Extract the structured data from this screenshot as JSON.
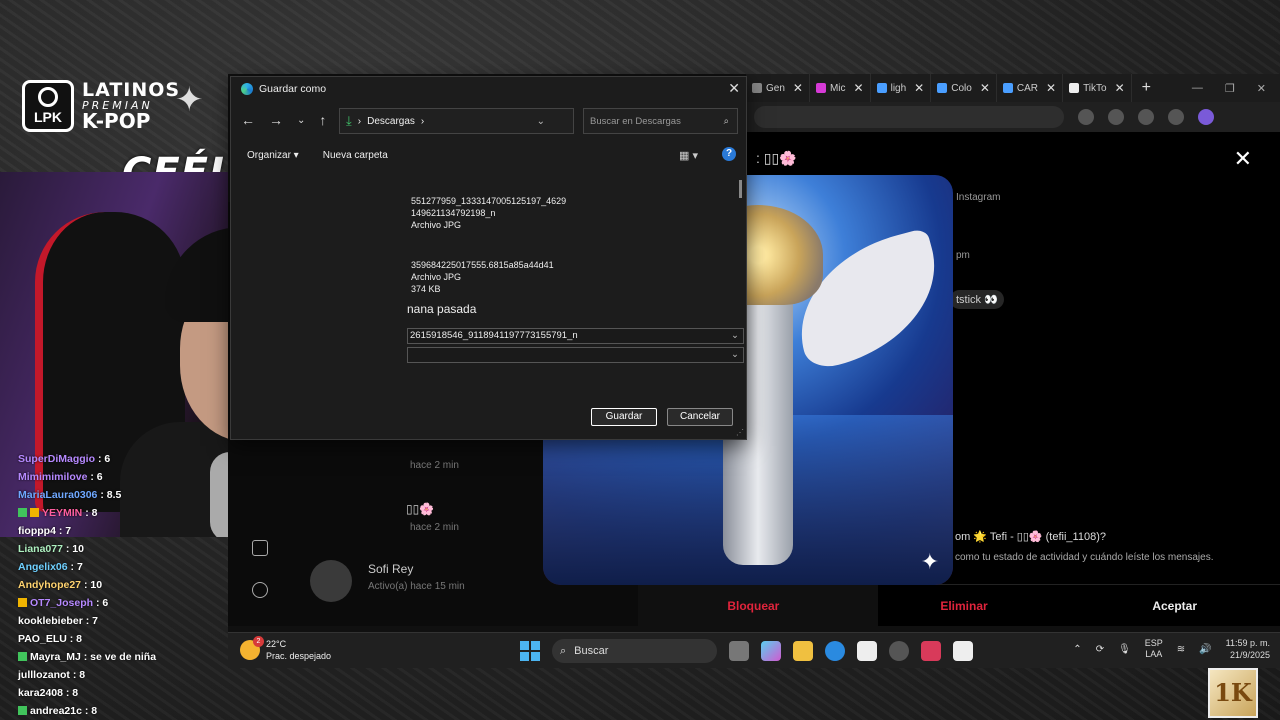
{
  "overlay": {
    "logo_badge": "LPK",
    "logo_line1": "LATINOS",
    "logo_line2": "PREMIAN",
    "logo_line3": "K-POP",
    "streamer_tag": "CEÉLE",
    "corner_logo": "1K"
  },
  "chat": [
    {
      "user": "SuperDiMaggio",
      "msg": ": 6",
      "color": "#b689ff"
    },
    {
      "user": "Mimimimilove",
      "msg": ": 6",
      "color": "#b689ff"
    },
    {
      "user": "MariaLaura0306",
      "msg": ": 8.5",
      "color": "#6fa8ff"
    },
    {
      "user": "YEYMIN",
      "msg": ": 8",
      "color": "#ff5fa0",
      "badges": [
        "#41c45c",
        "#f0b400"
      ]
    },
    {
      "user": "fioppp4",
      "msg": ": 7",
      "color": "#ffffff"
    },
    {
      "user": "Liana077",
      "msg": ": 10",
      "color": "#aef0c0"
    },
    {
      "user": "Angelix06",
      "msg": ": 7",
      "color": "#6fd0ff"
    },
    {
      "user": "Andyhope27",
      "msg": ": 10",
      "color": "#ffd36f"
    },
    {
      "user": "OT7_Joseph",
      "msg": ": 6",
      "color": "#b689ff",
      "badges": [
        "#f0b400"
      ]
    },
    {
      "user": "kooklebieber",
      "msg": ": 7",
      "color": "#ffffff"
    },
    {
      "user": "PAO_ELU",
      "msg": ": 8",
      "color": "#ffffff"
    },
    {
      "user": "Mayra_MJ",
      "msg": ": se ve de niña",
      "color": "#ffffff",
      "badges": [
        "#41c45c"
      ]
    },
    {
      "user": "julllozanot",
      "msg": ": 8",
      "color": "#ffffff"
    },
    {
      "user": "kara2408",
      "msg": ": 8",
      "color": "#ffffff"
    },
    {
      "user": "andrea21c",
      "msg": ": 8",
      "color": "#ffffff",
      "badges": [
        "#41c45c"
      ]
    }
  ],
  "browser": {
    "tabs": [
      {
        "label": "Gen",
        "color": "#888"
      },
      {
        "label": "Mic",
        "color": "#d63ad6"
      },
      {
        "label": "ligh",
        "color": "#4a9eff"
      },
      {
        "label": "Colo",
        "color": "#4a9eff"
      },
      {
        "label": "CAR",
        "color": "#4a9eff"
      },
      {
        "label": "TikTo",
        "color": "#eee"
      }
    ],
    "new_tab": "+",
    "close_glyph": "✕"
  },
  "instagram": {
    "chat_title": ": ▯▯🌸",
    "close": "✕",
    "label_instagram": "Instagram",
    "time_pm": "pm",
    "lightstick_text": "tstick 👀",
    "row1_time": "hace 2 min",
    "row2_label": "▯▯🌸",
    "row2_time": "hace 2 min",
    "sofi_name": "Sofi Rey",
    "sofi_status": "Activo(a) hace 15 min",
    "request_title": "om 🌟 Tefi - ▯▯🌸 (tefii_1108)?",
    "request_sub": "como tu estado de actividad y cuándo leíste los mensajes.",
    "actions": [
      "Bloquear",
      "Eliminar",
      "Aceptar"
    ]
  },
  "dialog": {
    "title": "Guardar como",
    "close": "✕",
    "path_folder": "Descargas",
    "path_sep": "›",
    "search_placeholder": "Buscar en Descargas",
    "organize": "Organizar ▾",
    "new_folder": "Nueva carpeta",
    "help": "?",
    "files": [
      {
        "line1": "551277959_1333147005125197_4629",
        "line2": "149621134792198_n",
        "line3": "Archivo JPG"
      },
      {
        "line1": "359684225017555.6815a85a44d41",
        "line2": "Archivo JPG",
        "line3": "374 KB"
      }
    ],
    "group_header": "nana pasada",
    "filename_value": "2615918546_9118941197773155791_n",
    "filetype_value": "",
    "save_button": "Guardar",
    "cancel_button": "Cancelar"
  },
  "taskbar": {
    "temp": "22°C",
    "condition": "Prac. despejado",
    "weather_badge": "2",
    "search_label": "Buscar",
    "lang1": "ESP",
    "lang2": "LAA",
    "time": "11:59 p. m.",
    "date": "21/9/2025"
  }
}
